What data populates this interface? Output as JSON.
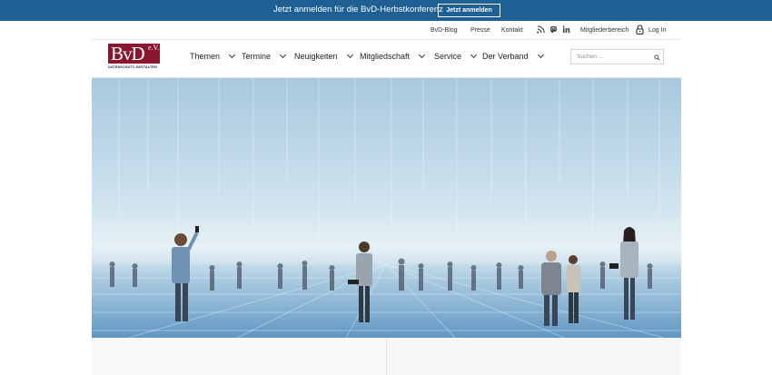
{
  "banner": {
    "text": "Jetzt anmelden für die BvD-Herbstkonferenz",
    "button_label": "Jetzt anmelden"
  },
  "util": {
    "blog": "BvD-Blog",
    "presse": "Presse",
    "kontakt": "Kontakt",
    "icons": [
      "rss-icon",
      "mastodon-icon",
      "linkedin-icon"
    ],
    "member_area": "Mitgliederbereich",
    "login": "Log In"
  },
  "logo": {
    "text": "BvD",
    "ev": "e.V.",
    "tagline": "DATENSCHUTZ GESTALTEN"
  },
  "nav": {
    "items": [
      {
        "label": "Themen"
      },
      {
        "label": "Termine"
      },
      {
        "label": "Neuigkeiten"
      },
      {
        "label": "Mitgliedschaft"
      },
      {
        "label": "Service"
      },
      {
        "label": "Der Verband"
      }
    ]
  },
  "search": {
    "placeholder": "Suchen ..."
  },
  "colors": {
    "banner": "#1e5f94",
    "logo": "#8a1730",
    "hero_sky": "#c4dcea"
  }
}
